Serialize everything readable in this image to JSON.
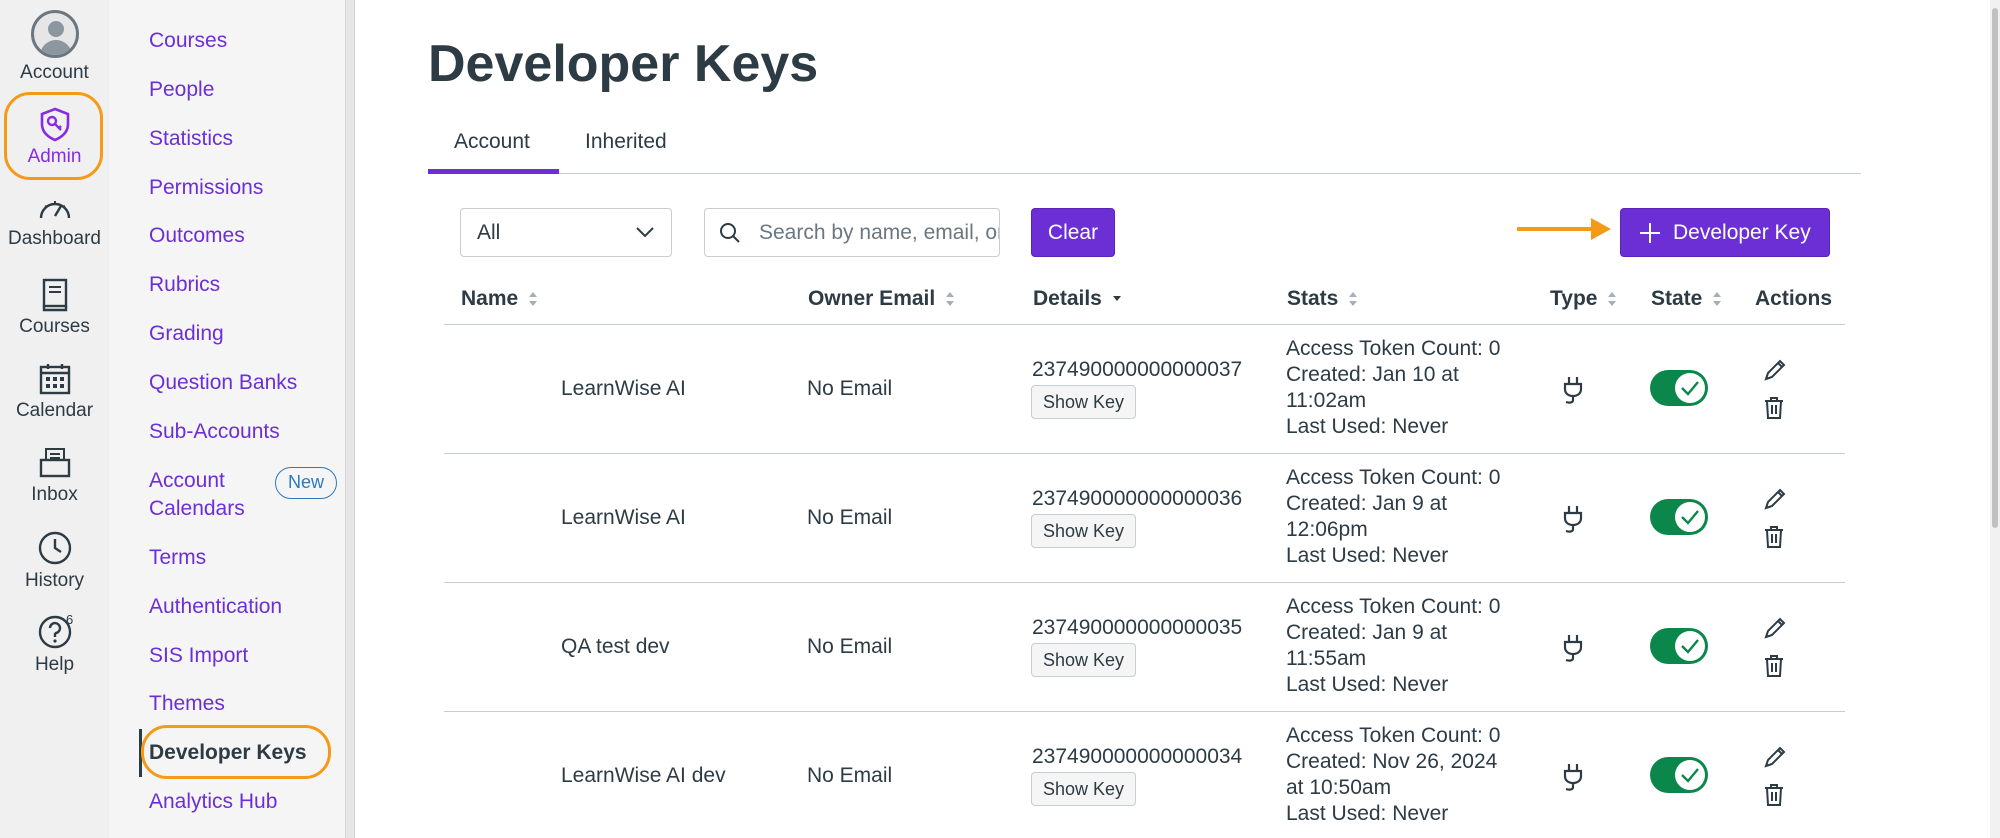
{
  "global_nav": {
    "account": "Account",
    "admin": "Admin",
    "dashboard": "Dashboard",
    "courses": "Courses",
    "calendar": "Calendar",
    "inbox": "Inbox",
    "history": "History",
    "help": "Help",
    "help_badge": "6"
  },
  "sub_nav": {
    "items": [
      "Courses",
      "People",
      "Statistics",
      "Permissions",
      "Outcomes",
      "Rubrics",
      "Grading",
      "Question Banks",
      "Sub-Accounts",
      "Account",
      "Calendars",
      "Terms",
      "Authentication",
      "SIS Import",
      "Themes",
      "Developer Keys",
      "Analytics Hub"
    ],
    "new_badge": "New",
    "active": "Developer Keys"
  },
  "page": {
    "title": "Developer Keys",
    "tabs": [
      "Account",
      "Inherited"
    ],
    "filter_value": "All",
    "search_placeholder": "Search by name, email, or ID",
    "clear_label": "Clear",
    "add_label": "Developer Key"
  },
  "table": {
    "headers": [
      "Name",
      "Owner Email",
      "Details",
      "Stats",
      "Type",
      "State",
      "Actions"
    ],
    "show_key_label": "Show Key",
    "rows": [
      {
        "name": "LearnWise AI",
        "email": "No Email",
        "id": "237490000000000037",
        "stats": [
          "Access Token Count: 0",
          "Created: Jan 10 at",
          "11:02am",
          "Last Used: Never"
        ]
      },
      {
        "name": "LearnWise AI",
        "email": "No Email",
        "id": "237490000000000036",
        "stats": [
          "Access Token Count: 0",
          "Created: Jan 9 at",
          "12:06pm",
          "Last Used: Never"
        ]
      },
      {
        "name": "QA test dev",
        "email": "No Email",
        "id": "237490000000000035",
        "stats": [
          "Access Token Count: 0",
          "Created: Jan 9 at",
          "11:55am",
          "Last Used: Never"
        ]
      },
      {
        "name": "LearnWise AI dev",
        "email": "No Email",
        "id": "237490000000000034",
        "stats": [
          "Access Token Count: 0",
          "Created: Nov 26, 2024",
          "at 10:50am",
          "Last Used: Never"
        ]
      }
    ]
  },
  "colors": {
    "accent": "#6c2fd6",
    "highlight": "#f59a16",
    "toggle_on": "#0b874b"
  }
}
